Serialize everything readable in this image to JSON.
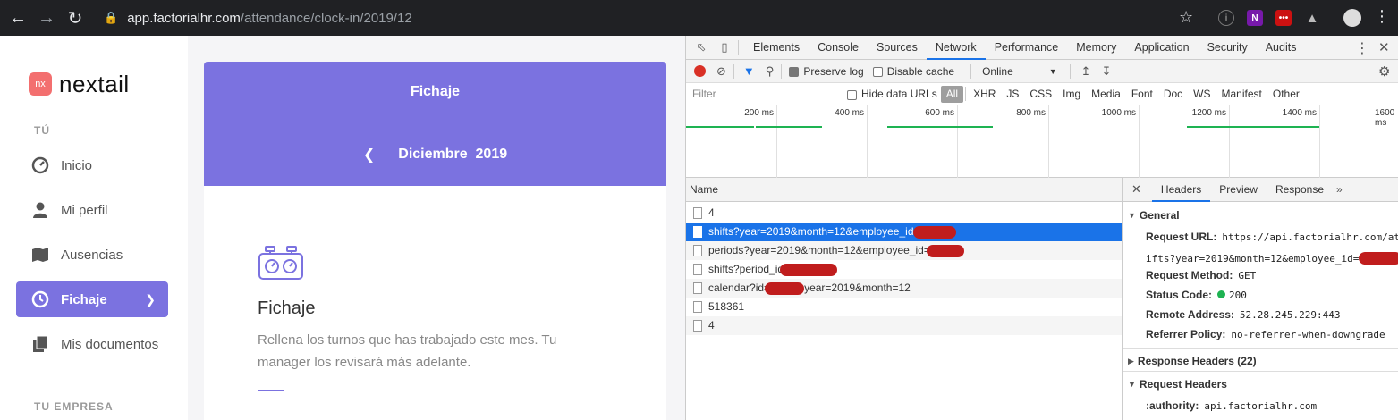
{
  "browser": {
    "url_host": "app.factorialhr.com",
    "url_path": "/attendance/clock-in/2019/12"
  },
  "app": {
    "logo_badge": "nx",
    "logo_text": "nextail",
    "section_you": "TÚ",
    "section_company": "TU EMPRESA",
    "nav": [
      {
        "label": "Inicio",
        "icon": "dashboard-icon"
      },
      {
        "label": "Mi perfil",
        "icon": "user-icon"
      },
      {
        "label": "Ausencias",
        "icon": "map-icon"
      },
      {
        "label": "Fichaje",
        "icon": "clock-icon",
        "active": true
      },
      {
        "label": "Mis documentos",
        "icon": "documents-icon"
      }
    ],
    "card_title": "Fichaje",
    "month": "Diciembre",
    "year": "2019",
    "heading": "Fichaje",
    "description": "Rellena los turnos que has trabajado este mes. Tu manager los revisará más adelante.",
    "accent": "#7b72e0"
  },
  "devtools": {
    "tabs": [
      "Elements",
      "Console",
      "Sources",
      "Network",
      "Performance",
      "Memory",
      "Application",
      "Security",
      "Audits"
    ],
    "active_tab": "Network",
    "toolbar": {
      "preserve_log": "Preserve log",
      "disable_cache": "Disable cache",
      "throttle": "Online"
    },
    "filter_placeholder": "Filter",
    "hide_data_urls": "Hide data URLs",
    "types": [
      "All",
      "XHR",
      "JS",
      "CSS",
      "Img",
      "Media",
      "Font",
      "Doc",
      "WS",
      "Manifest",
      "Other"
    ],
    "timeline_ticks": [
      "200 ms",
      "400 ms",
      "600 ms",
      "800 ms",
      "1000 ms",
      "1200 ms",
      "1400 ms",
      "1600 ms"
    ],
    "list_header": "Name",
    "requests": [
      {
        "name": "4"
      },
      {
        "name": "shifts?year=2019&month=12&employee_id=",
        "selected": true
      },
      {
        "name": "periods?year=2019&month=12&employee_id="
      },
      {
        "name": "shifts?period_id"
      },
      {
        "name": "calendar?id=",
        "suffix": "year=2019&month=12"
      },
      {
        "name": "518361"
      },
      {
        "name": "4"
      }
    ],
    "detail_tabs": [
      "Headers",
      "Preview",
      "Response"
    ],
    "detail_more": "»",
    "general_label": "General",
    "request_url_label": "Request URL:",
    "request_url_1": "https://api.factorialhr.com/at",
    "request_url_2": "ifts?year=2019&month=12&employee_id=",
    "request_method_label": "Request Method:",
    "request_method": "GET",
    "status_code_label": "Status Code:",
    "status_code": "200",
    "remote_address_label": "Remote Address:",
    "remote_address": "52.28.245.229:443",
    "referrer_policy_label": "Referrer Policy:",
    "referrer_policy": "no-referrer-when-downgrade",
    "response_headers_label": "Response Headers (22)",
    "request_headers_label": "Request Headers",
    "authority_label": ":authority:",
    "authority": "api.factorialhr.com"
  }
}
